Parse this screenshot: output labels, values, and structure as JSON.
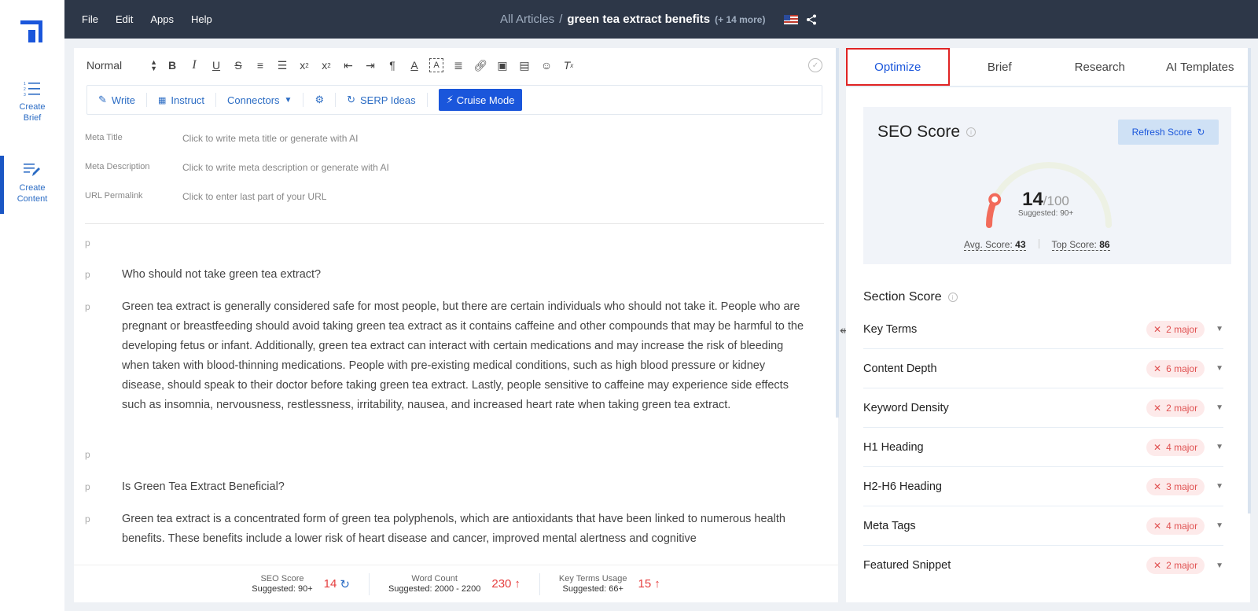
{
  "sidebar": {
    "items": [
      {
        "label_1": "Create",
        "label_2": "Brief",
        "icon": "list-numbered-icon"
      },
      {
        "label_1": "Create",
        "label_2": "Content",
        "icon": "edit-lines-icon"
      }
    ]
  },
  "topbar": {
    "menu": [
      "File",
      "Edit",
      "Apps",
      "Help"
    ],
    "breadcrumb_root": "All Articles",
    "breadcrumb_sep": "/",
    "current_article": "green tea extract benefits",
    "more_count": "(+ 14 more)"
  },
  "toolbar": {
    "format_select": "Normal"
  },
  "actions": {
    "write": "Write",
    "instruct": "Instruct",
    "connectors": "Connectors",
    "serp_ideas": "SERP Ideas",
    "cruise_mode": "Cruise Mode"
  },
  "meta": {
    "title_label": "Meta Title",
    "title_placeholder": "Click to write meta title or generate with AI",
    "desc_label": "Meta Description",
    "desc_placeholder": "Click to write meta description or generate with AI",
    "url_label": "URL Permalink",
    "url_placeholder": "Click to enter last part of your URL"
  },
  "content": {
    "tag": "p",
    "p1": "",
    "p2": "Who should not take green tea extract?",
    "p3": "Green tea extract is generally considered safe for most people, but there are certain individuals who should not take it. People who are pregnant or breastfeeding should avoid taking green tea extract as it contains caffeine and other compounds that may be harmful to the developing fetus or infant. Additionally, green tea extract can interact with certain medications and may increase the risk of bleeding when taken with blood-thinning medications. People with pre-existing medical conditions, such as high blood pressure or kidney disease, should speak to their doctor before taking green tea extract. Lastly, people sensitive to caffeine may experience side effects such as insomnia, nervousness, restlessness, irritability, nausea, and increased heart rate when taking green tea extract.",
    "p4": "",
    "p5": "Is Green Tea Extract Beneficial?",
    "p6": "Green tea extract is a concentrated form of green tea polyphenols, which are antioxidants that have been linked to numerous health benefits. These benefits include a lower risk of heart disease and cancer, improved mental alertness and cognitive"
  },
  "stats": {
    "seo_label": "SEO Score",
    "seo_sugg": "Suggested: 90+",
    "seo_value": "14",
    "wc_label": "Word Count",
    "wc_sugg": "Suggested: 2000 - 2200",
    "wc_value": "230",
    "kt_label": "Key Terms Usage",
    "kt_sugg": "Suggested: 66+",
    "kt_value": "15"
  },
  "right_tabs": [
    "Optimize",
    "Brief",
    "Research",
    "AI Templates"
  ],
  "seo_card": {
    "title": "SEO Score",
    "refresh": "Refresh Score",
    "score": "14",
    "max": "/100",
    "suggested": "Suggested: 90+",
    "score_fraction": 0.14,
    "avg_label": "Avg. Score:",
    "avg_value": "43",
    "top_label": "Top Score:",
    "top_value": "86"
  },
  "section_score": {
    "title": "Section Score",
    "rows": [
      {
        "name": "Key Terms",
        "badge": "2 major"
      },
      {
        "name": "Content Depth",
        "badge": "6 major"
      },
      {
        "name": "Keyword Density",
        "badge": "2 major"
      },
      {
        "name": "H1 Heading",
        "badge": "4 major"
      },
      {
        "name": "H2-H6 Heading",
        "badge": "3 major"
      },
      {
        "name": "Meta Tags",
        "badge": "4 major"
      },
      {
        "name": "Featured Snippet",
        "badge": "2 major"
      }
    ]
  },
  "colors": {
    "accent": "#1a56db",
    "topbar": "#2d3748",
    "danger": "#e53e3e"
  }
}
